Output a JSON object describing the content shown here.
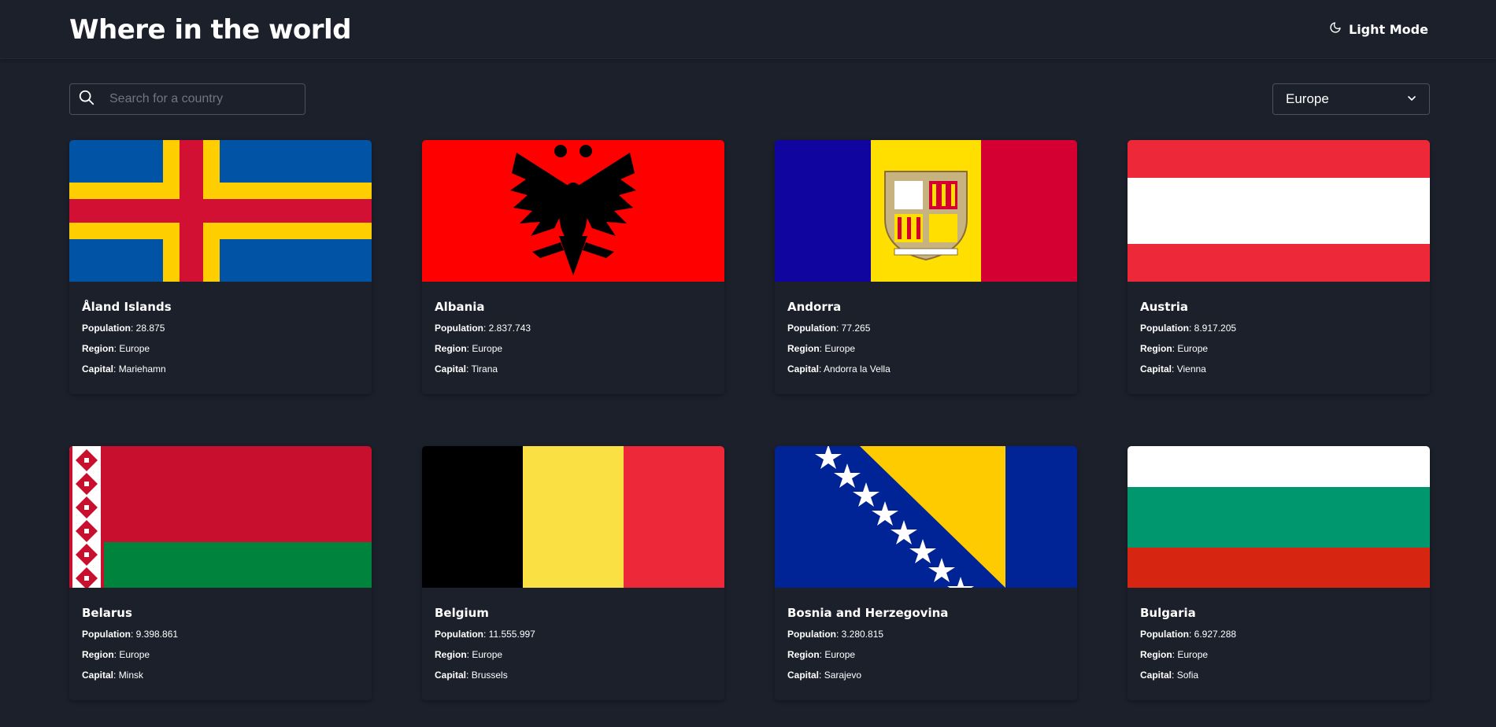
{
  "header": {
    "title": "Where in the world",
    "theme_toggle_label": "Light Mode",
    "theme_toggle_icon": "moon-icon"
  },
  "search": {
    "placeholder": "Search for a country",
    "value": "",
    "icon": "search-icon"
  },
  "filter": {
    "selected": "Europe",
    "icon": "chevron-down-icon"
  },
  "labels": {
    "population": "Population",
    "region": "Region",
    "capital": "Capital"
  },
  "countries": [
    {
      "name": "Åland Islands",
      "population": "28.875",
      "region": "Europe",
      "capital": "Mariehamn"
    },
    {
      "name": "Albania",
      "population": "2.837.743",
      "region": "Europe",
      "capital": "Tirana"
    },
    {
      "name": "Andorra",
      "population": "77.265",
      "region": "Europe",
      "capital": "Andorra la Vella"
    },
    {
      "name": "Austria",
      "population": "8.917.205",
      "region": "Europe",
      "capital": "Vienna"
    },
    {
      "name": "Belarus",
      "population": "9.398.861",
      "region": "Europe",
      "capital": "Minsk"
    },
    {
      "name": "Belgium",
      "population": "11.555.997",
      "region": "Europe",
      "capital": "Brussels"
    },
    {
      "name": "Bosnia and Herzegovina",
      "population": "3.280.815",
      "region": "Europe",
      "capital": "Sarajevo"
    },
    {
      "name": "Bulgaria",
      "population": "6.927.288",
      "region": "Europe",
      "capital": "Sofia"
    }
  ],
  "colors": {
    "background": "#1c202b",
    "border": "#4b5160",
    "text": "#ffffff"
  }
}
